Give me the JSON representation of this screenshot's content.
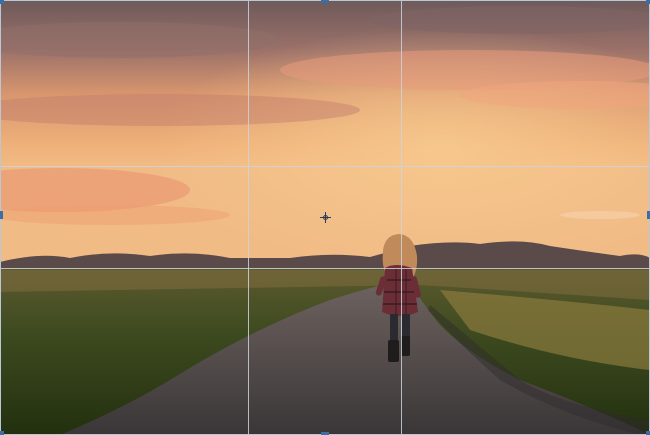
{
  "canvas": {
    "image_description_label": "",
    "accent_color": "#3a6ea5",
    "grid_color": "#cdd4dc",
    "overlay": "rule-of-thirds"
  },
  "icons": {
    "pivot": "crosshair-pivot-icon"
  }
}
